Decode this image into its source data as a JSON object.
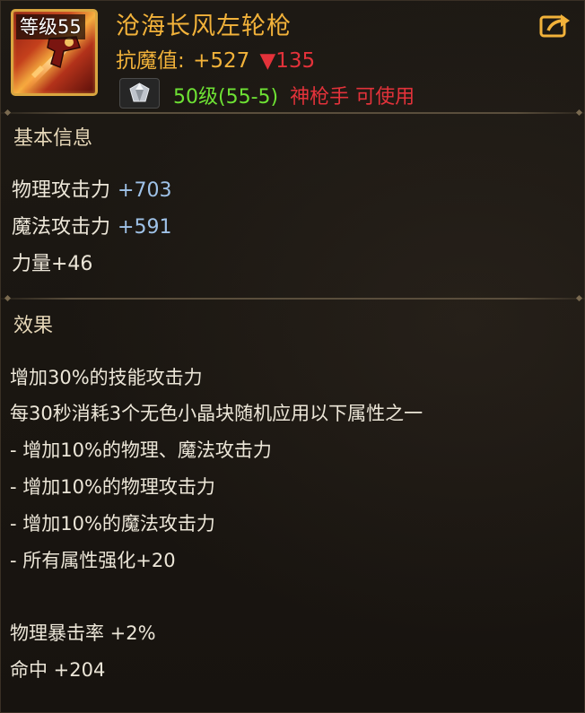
{
  "item": {
    "level_badge": "等级55",
    "name": "沧海长风左轮枪",
    "resist_label": "抗魔值:",
    "resist_value": "+527",
    "resist_delta": "▼135",
    "requirement_level": "50级(55-5)",
    "requirement_class": "神枪手 可使用",
    "icon": "revolver-weapon-icon",
    "gem_icon": "diamond-icon",
    "share_icon": "share-icon"
  },
  "basic_info": {
    "title": "基本信息",
    "stats": [
      {
        "label": "物理攻击力",
        "value": "+703"
      },
      {
        "label": "魔法攻击力",
        "value": "+591"
      },
      {
        "label": "力量+46",
        "value": ""
      }
    ]
  },
  "effects": {
    "title": "效果",
    "lines": [
      "增加30%的技能攻击力",
      "每30秒消耗3个无色小晶块随机应用以下属性之一",
      "- 增加10%的物理、魔法攻击力",
      "- 增加10%的物理攻击力",
      "- 增加10%的魔法攻击力",
      "- 所有属性强化+20"
    ],
    "extra": [
      "物理暴击率 +2%",
      "命中 +204"
    ]
  },
  "colors": {
    "gold": "#f2b23a",
    "red": "#e3323a",
    "green": "#6ee234",
    "blue": "#9fc2e8",
    "text": "#ece6d8",
    "background": "#1b1712"
  }
}
